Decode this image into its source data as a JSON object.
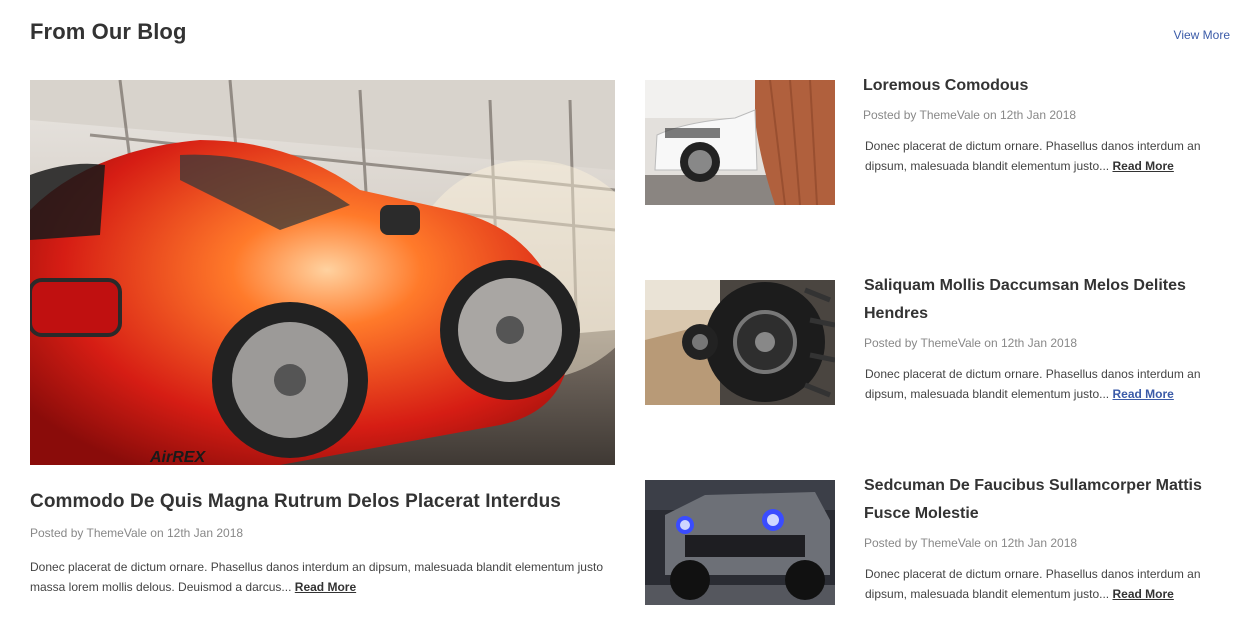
{
  "section": {
    "title": "From Our Blog",
    "view_more": "View More"
  },
  "featured": {
    "image": "red-sports-car-photo",
    "title": "Commodo De Quis Magna Rutrum Delos Placerat Interdus",
    "meta": "Posted by ThemeVale on 12th Jan 2018",
    "excerpt": "Donec placerat de dictum ornare. Phasellus danos interdum an dipsum, malesuada blandit elementum justo massa lorem mollis delous. Deuismod a darcus...",
    "read_more": "Read More"
  },
  "posts": [
    {
      "image": "white-suv-photo",
      "title": "Loremous Comodous",
      "meta": "Posted by ThemeVale on 12th Jan 2018",
      "excerpt": "Donec placerat de dictum ornare. Phasellus danos interdum an dipsum, malesuada blandit elementum justo...",
      "read_more": "Read More"
    },
    {
      "image": "offroad-tire-photo",
      "title": "Saliquam Mollis Daccumsan Melos Delites Hendres",
      "meta": "Posted by ThemeVale on 12th Jan 2018",
      "excerpt": "Donec placerat de dictum ornare. Phasellus danos interdum an dipsum, malesuada blandit elementum justo...",
      "read_more": "Read More"
    },
    {
      "image": "lifted-truck-photo",
      "title": "Sedcuman De Faucibus Sullamcorper Mattis Fusce Molestie",
      "meta": "Posted by ThemeVale on 12th Jan 2018",
      "excerpt": "Donec placerat de dictum ornare. Phasellus danos interdum an dipsum, malesuada blandit elementum justo...",
      "read_more": "Read More"
    }
  ],
  "colors": {
    "heading": "#333333",
    "meta": "#888888",
    "link_accent": "#3b5ba8"
  }
}
